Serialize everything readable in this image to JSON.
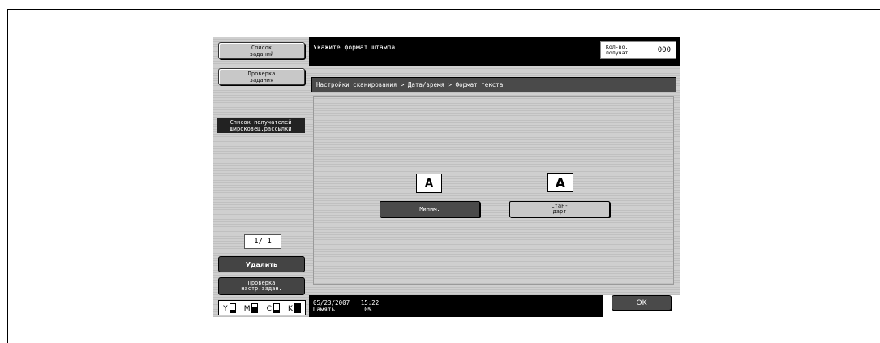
{
  "sidebar": {
    "job_list_label": "Список\nзаданий",
    "job_check_label": "Проверка\nзадания",
    "broadcast_header": "Список получателей\nшироковещ.рассылки",
    "page_indicator": "1/ 1",
    "delete_label": "Удалить",
    "check_settings_label": "Проверка\nнастр.задан.",
    "toner": [
      {
        "name": "Y",
        "level": 0.25
      },
      {
        "name": "M",
        "level": 0.6
      },
      {
        "name": "C",
        "level": 0.25
      },
      {
        "name": "K",
        "level": 1.0
      }
    ]
  },
  "header": {
    "message": "Укажите формат штампа.",
    "recipients_label": "Кол-во.\nполучат.",
    "recipients_count": "000"
  },
  "breadcrumb": "Настройки сканирования > Дата/время > Формат текста",
  "options": {
    "minimum_sample": "A",
    "minimum_label": "Миним.",
    "standard_sample": "A",
    "standard_label": "Стан-\nдарт",
    "selected": "minimum"
  },
  "status": {
    "datetime": "05/23/2007   15:22",
    "memory": "Память        0%"
  },
  "ok_label": "OK",
  "colors": {
    "panel_gray": "#cfcfcf",
    "dark": "#4a4a4a",
    "black": "#000000"
  }
}
